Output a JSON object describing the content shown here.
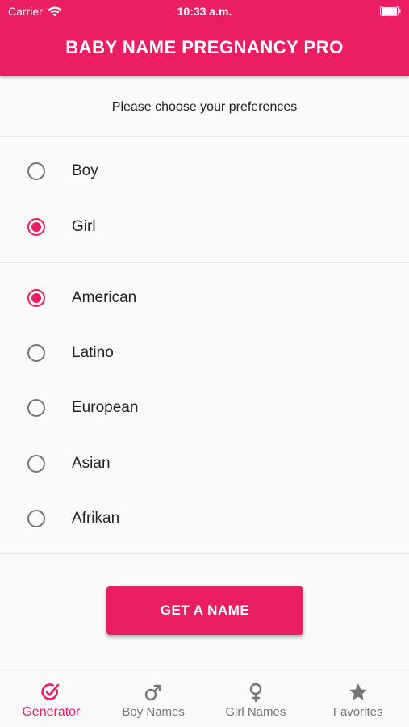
{
  "status": {
    "carrier": "Carrier",
    "time": "10:33 a.m."
  },
  "appbar": {
    "title": "BABY NAME PREGNANCY PRO"
  },
  "prompt": "Please choose your preferences",
  "gender_options": [
    {
      "label": "Boy",
      "selected": false
    },
    {
      "label": "Girl",
      "selected": true
    }
  ],
  "origin_options": [
    {
      "label": "American",
      "selected": true
    },
    {
      "label": "Latino",
      "selected": false
    },
    {
      "label": "European",
      "selected": false
    },
    {
      "label": "Asian",
      "selected": false
    },
    {
      "label": "Afrikan",
      "selected": false
    }
  ],
  "action_button": "GET A NAME",
  "bottom_nav": [
    {
      "label": "Generator",
      "icon": "generator-icon",
      "active": true
    },
    {
      "label": "Boy Names",
      "icon": "male-symbol-icon",
      "active": false
    },
    {
      "label": "Girl Names",
      "icon": "female-symbol-icon",
      "active": false
    },
    {
      "label": "Favorites",
      "icon": "star-icon",
      "active": false
    }
  ],
  "colors": {
    "primary": "#e91e63",
    "inactive": "#757575",
    "background": "#fafafa"
  }
}
